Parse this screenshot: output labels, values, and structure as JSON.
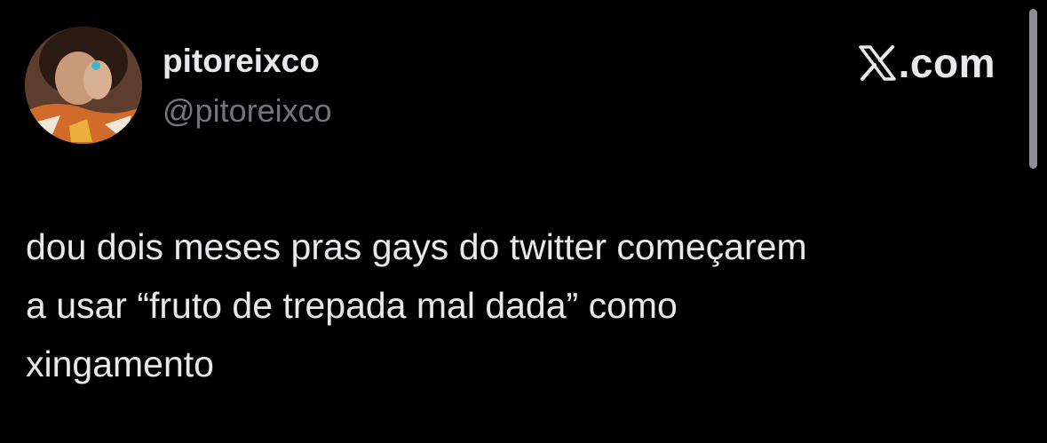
{
  "author": {
    "display_name": "pitoreixco",
    "handle": "@pitoreixco"
  },
  "source": {
    "icon": "x-logo-icon",
    "label": ".com"
  },
  "tweet": {
    "text": "dou dois meses pras gays do twitter começarem\na usar “fruto de trepada mal dada” como\nxingamento"
  },
  "colors": {
    "background": "#000000",
    "primary_text": "#e7e9ea",
    "secondary_text": "#71767b"
  }
}
